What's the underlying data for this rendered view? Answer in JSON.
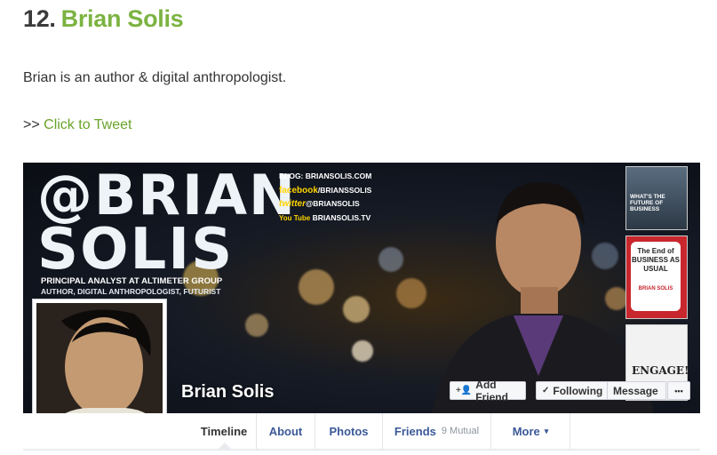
{
  "heading": {
    "number": "12.",
    "name": "Brian Solis"
  },
  "description": "Brian is an author & digital anthropologist.",
  "tweet": {
    "prefix": ">>",
    "link": "Click to Tweet"
  },
  "cover": {
    "big_text_line1": "@BRIAN",
    "big_text_line2": "SOLIS",
    "subtitle1": "PRINCIPAL ANALYST AT ALTIMETER GROUP",
    "subtitle2": "AUTHOR, DIGITAL ANTHROPOLOGIST, FUTURIST",
    "social": {
      "blog": "BLOG: BRIANSOLIS.COM",
      "facebook_brand": "facebook",
      "facebook": "/BRIANSSOLIS",
      "twitter_brand": "twitter",
      "twitter": "@BRIANSOLIS",
      "youtube_brand": "You Tube",
      "youtube": "BRIANSOLIS.TV"
    },
    "books": [
      {
        "title": "WHAT'S THE FUTURE OF BUSINESS"
      },
      {
        "title": "The End of BUSINESS AS USUAL",
        "author": "BRIAN SOLIS"
      },
      {
        "title": "ENGAGE!"
      }
    ]
  },
  "profile": {
    "name": "Brian Solis",
    "buttons": {
      "add_friend": "Add Friend",
      "following": "Following",
      "message": "Message",
      "more": "•••"
    }
  },
  "tabs": [
    {
      "label": "Timeline"
    },
    {
      "label": "About"
    },
    {
      "label": "Photos"
    },
    {
      "label": "Friends",
      "extra": "9 Mutual"
    },
    {
      "label": "More"
    }
  ],
  "colors": {
    "accent_green": "#7cb342",
    "link_green": "#6aa329",
    "fb_blue": "#3b5998"
  }
}
